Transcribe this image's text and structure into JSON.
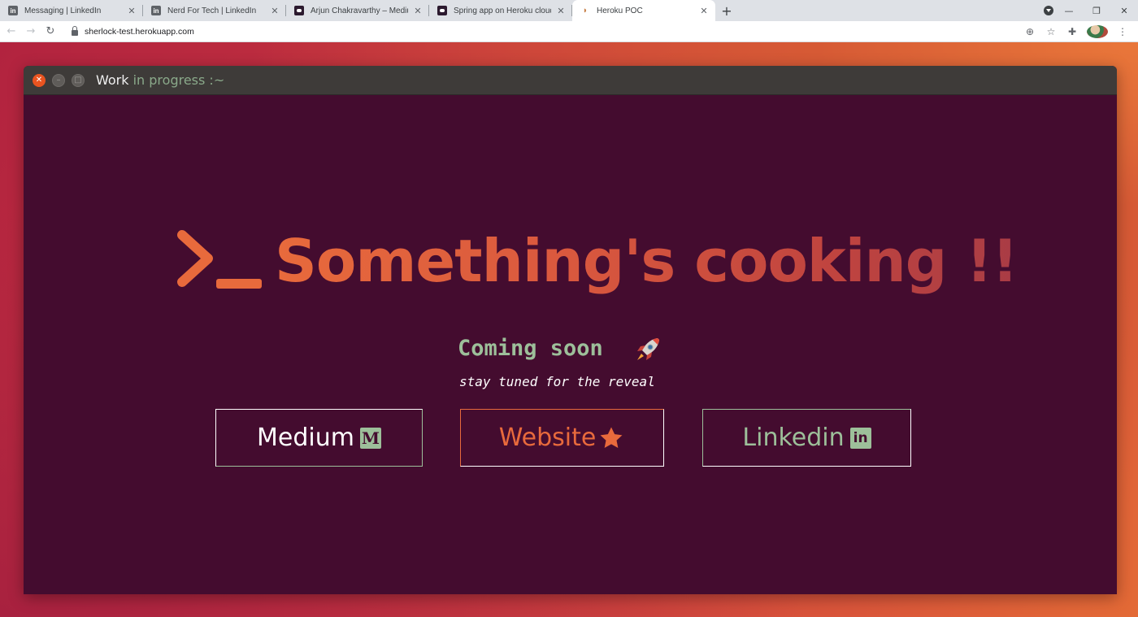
{
  "browser": {
    "tabs": [
      {
        "title": "Messaging | LinkedIn",
        "favicon": "linkedin-icon",
        "active": false
      },
      {
        "title": "Nerd For Tech | LinkedIn",
        "favicon": "linkedin-icon",
        "active": false
      },
      {
        "title": "Arjun Chakravarthy – Medium",
        "favicon": "medium-icon",
        "active": false
      },
      {
        "title": "Spring app on Heroku cloud with",
        "favicon": "medium-icon",
        "active": false
      },
      {
        "title": "Heroku POC",
        "favicon": "heroku-icon",
        "active": true
      }
    ],
    "url": "sherlock-test.herokuapp.com"
  },
  "terminal": {
    "title_word": "Work",
    "title_rest": " in progress :~",
    "headline": "Something's cooking !!",
    "subtitle": "Coming soon",
    "tagline": "stay tuned for the reveal",
    "buttons": {
      "medium": {
        "label": "Medium",
        "icon": "M"
      },
      "website": {
        "label": "Website",
        "icon": "star-icon"
      },
      "linkedin": {
        "label": "Linkedin",
        "icon": "in"
      }
    }
  },
  "colors": {
    "terminal_bg": "#440c2f",
    "accent_orange": "#e86a3c",
    "accent_green": "#9dbf9a",
    "titlebar": "#3e3b39"
  }
}
